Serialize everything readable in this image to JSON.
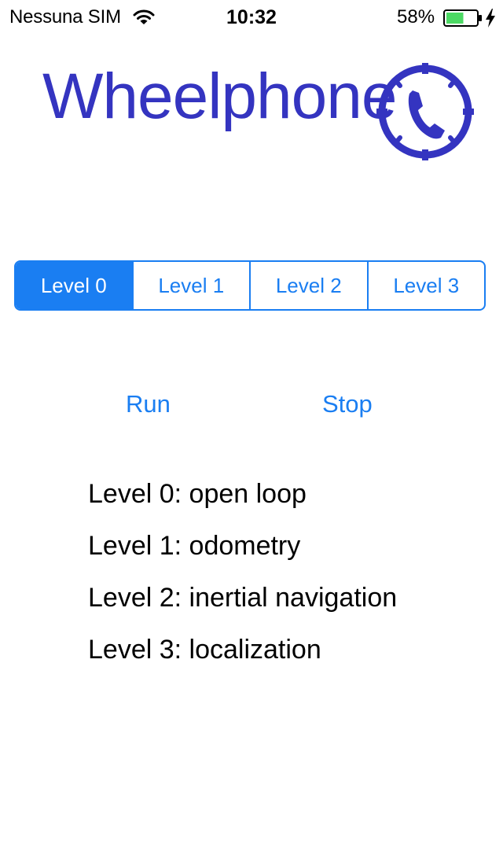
{
  "status_bar": {
    "carrier": "Nessuna SIM",
    "time": "10:32",
    "battery_percent": "58%",
    "battery_level": 0.58,
    "wifi_icon": "wifi-icon",
    "charging_icon": "bolt-icon"
  },
  "header": {
    "logo_text": "Wheelphone",
    "logo_icon": "phone-in-dial-icon",
    "logo_color": "#3434c0"
  },
  "levels_control": {
    "segments": [
      "Level 0",
      "Level 1",
      "Level 2",
      "Level 3"
    ],
    "selected_index": 0,
    "accent_color": "#1a7ef2"
  },
  "actions": {
    "run_label": "Run",
    "stop_label": "Stop"
  },
  "descriptions": [
    "Level 0: open loop",
    "Level 1: odometry",
    "Level 2: inertial navigation",
    "Level 3: localization"
  ]
}
